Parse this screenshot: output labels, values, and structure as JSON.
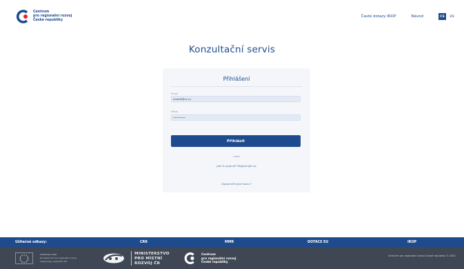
{
  "header": {
    "logo_lines": [
      "Centrum",
      "pro regionální rozvoj",
      "České republiky"
    ],
    "nav_faq": "Časté dotazy IROP",
    "nav_help": "Návod",
    "lang_cs": "CS",
    "lang_en": "EN"
  },
  "main": {
    "title": "Konzultační servis"
  },
  "login": {
    "title": "Přihlášení",
    "email_label": "Email",
    "email_value": "testett@ce.cz",
    "password_label": "Heslo",
    "password_value": "••••••••",
    "submit_label": "Přihlásit",
    "or_text": "nebo",
    "register_text": "Jste tu poprvé? Registrujte se",
    "forgot_text": "Zapomněli jste heslo ?"
  },
  "footer": {
    "useful_links_label": "Užitečné odkazy:",
    "links": [
      "CRR",
      "MMR",
      "DOTACE EU",
      "IROP"
    ],
    "eu_text": [
      "EVROPSKÁ UNIE",
      "Evropský fond pro regionální rozvoj",
      "Integrovaný regionální OP"
    ],
    "mmr_text": [
      "MINISTERSTVO",
      "PRO MÍSTNÍ",
      "ROZVOJ ČR"
    ],
    "crr_text": [
      "Centrum",
      "pro regionální rozvoj",
      "České republiky"
    ],
    "copyright": "Centrum pro regionální rozvoj České republiky © 2021"
  },
  "colors": {
    "brand_blue": "#1e4b8e",
    "logo_red": "#e3242b",
    "footer_dark": "#3e4753"
  }
}
